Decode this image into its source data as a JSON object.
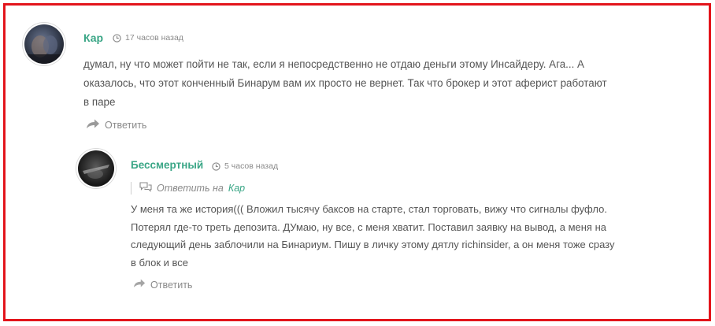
{
  "colors": {
    "border": "#e3141b",
    "accent": "#3aa686",
    "text": "#555555",
    "muted": "#8a8a8a"
  },
  "comments": [
    {
      "author": "Кар",
      "time": "17 часов назад",
      "text": "думал, ну что может пойти не так, если я непосредственно не отдаю деньги этому Инсайдеру. Ага... А оказалось, что этот конченный Бинарум вам их просто не вернет. Так что брокер и этот аферист работают в паре",
      "reply_label": "Ответить"
    },
    {
      "author": "Бессмертный",
      "time": "5 часов назад",
      "reply_to_label": "Ответить на",
      "reply_to_target": "Кар",
      "text": "У меня та же история((( Вложил тысячу баксов на старте, стал торговать, вижу что сигналы фуфло. Потерял где-то треть депозита. ДУмаю, ну все, с меня хватит. Поставил заявку на вывод, а меня на следующий день заблочили на Бинариум. Пишу в личку этому дятлу richinsider, а он меня тоже сразу в блок и все",
      "reply_label": "Ответить"
    }
  ],
  "icons": {
    "time": "clock-icon",
    "reply": "reply-arrow-icon",
    "reply_to": "speech-bubbles-icon"
  }
}
